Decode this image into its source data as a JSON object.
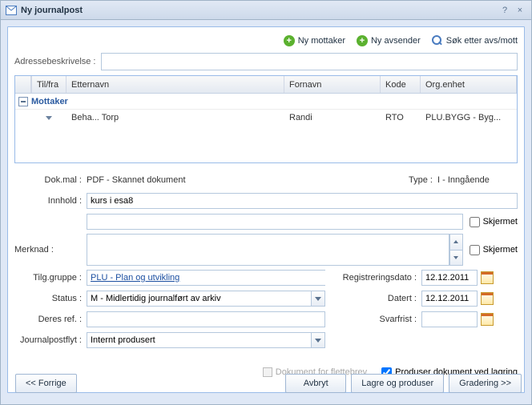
{
  "window": {
    "title": "Ny journalpost",
    "help": "?",
    "close": "×"
  },
  "toolbar": {
    "new_recipient": "Ny mottaker",
    "new_sender": "Ny avsender",
    "search": "Søk etter avs/mott"
  },
  "address": {
    "label": "Adressebeskrivelse :"
  },
  "grid": {
    "columns": {
      "tilfra": "Til/fra",
      "etternavn": "Etternavn",
      "fornavn": "Fornavn",
      "kode": "Kode",
      "orgenhet": "Org.enhet"
    },
    "group_label": "Mottaker",
    "rows": [
      {
        "tilfra": "▾",
        "etternavn": "Beha... Torp",
        "fornavn": "Randi",
        "kode": "RTO",
        "orgenhet": "PLU.BYGG - Byg..."
      }
    ]
  },
  "form": {
    "dokmal_label": "Dok.mal :",
    "dokmal_value": "PDF - Skannet dokument",
    "type_label": "Type :",
    "type_value": "I - Inngående",
    "innhold_label": "Innhold :",
    "innhold_value": "kurs i esa8",
    "innhold2_value": "",
    "skjermet1": "Skjermet",
    "merknad_label": "Merknad :",
    "merknad_value": "",
    "skjermet2": "Skjermet",
    "tilg_label": "Tilg.gruppe :",
    "tilg_value": "PLU - Plan og utvikling",
    "status_label": "Status :",
    "status_value": "M - Midlertidig journalført av arkiv",
    "deres_label": "Deres ref. :",
    "deres_value": "",
    "flyt_label": "Journalpostflyt :",
    "flyt_value": "Internt produsert",
    "regdato_label": "Registreringsdato :",
    "regdato_value": "12.12.2011",
    "datert_label": "Datert :",
    "datert_value": "12.12.2011",
    "svarfrist_label": "Svarfrist :",
    "svarfrist_value": "",
    "flettebrev": "Dokument for flettebrev",
    "produser_lagring": "Produser dokument ved lagring"
  },
  "buttons": {
    "forrige": "<< Forrige",
    "avbryt": "Avbryt",
    "lagre": "Lagre og produser",
    "gradering": "Gradering >>"
  }
}
